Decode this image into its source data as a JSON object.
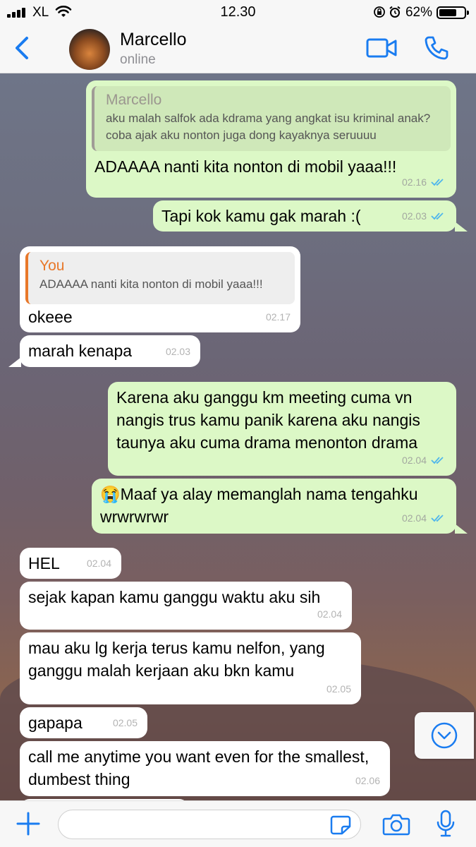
{
  "status_bar": {
    "carrier": "XL",
    "time": "12.30",
    "battery": "62%",
    "battery_level": 0.62
  },
  "header": {
    "back_label": "Back",
    "contact_name": "Marcello",
    "contact_status": "online"
  },
  "colors": {
    "accent": "#1a7cf0",
    "outgoing_bubble": "#dcf8c6",
    "incoming_bubble": "#ffffff",
    "you_quote": "#e8782a",
    "read_ticks": "#4fb6ec"
  },
  "messages": [
    {
      "dir": "out",
      "quote_name": "Marcello",
      "quote_text": "aku malah salfok ada kdrama yang angkat isu kriminal anak? coba ajak aku nonton juga dong kayaknya seruuuu",
      "text": "ADAAAA nanti kita nonton di mobil yaaa!!!",
      "time": "02.16"
    },
    {
      "dir": "out",
      "text": "Tapi kok kamu gak marah :(",
      "time": "02.03"
    },
    {
      "dir": "in",
      "quote_name": "You",
      "quote_text": "ADAAAA nanti kita nonton di mobil yaaa!!!",
      "text": "okeee",
      "time": "02.17"
    },
    {
      "dir": "in",
      "text": "marah kenapa",
      "time": "02.03"
    },
    {
      "dir": "out",
      "text": "Karena aku ganggu km meeting cuma vn nangis trus kamu panik karena aku nangis taunya aku cuma drama menonton drama",
      "time": "02.04"
    },
    {
      "dir": "out",
      "text": "😭Maaf ya alay memanglah nama tengahku wrwrwrwr",
      "time": "02.04"
    },
    {
      "dir": "in",
      "text": "HEL",
      "time": "02.04"
    },
    {
      "dir": "in",
      "text": "sejak kapan kamu ganggu waktu aku sih",
      "time": "02.04"
    },
    {
      "dir": "in",
      "text": "mau aku lg kerja terus kamu nelfon, yang ganggu malah kerjaan aku bkn kamu",
      "time": "02.05"
    },
    {
      "dir": "in",
      "text": "gapapa",
      "time": "02.05"
    },
    {
      "dir": "in",
      "text": "call me anytime you want even for the smallest, dumbest thing",
      "time": "02.06"
    }
  ],
  "input": {
    "value": "",
    "placeholder": ""
  },
  "icons": [
    "back-chevron-icon",
    "video-call-icon",
    "phone-icon",
    "scroll-down-icon",
    "plus-icon",
    "sticker-icon",
    "camera-icon",
    "microphone-icon",
    "double-check-icon"
  ]
}
